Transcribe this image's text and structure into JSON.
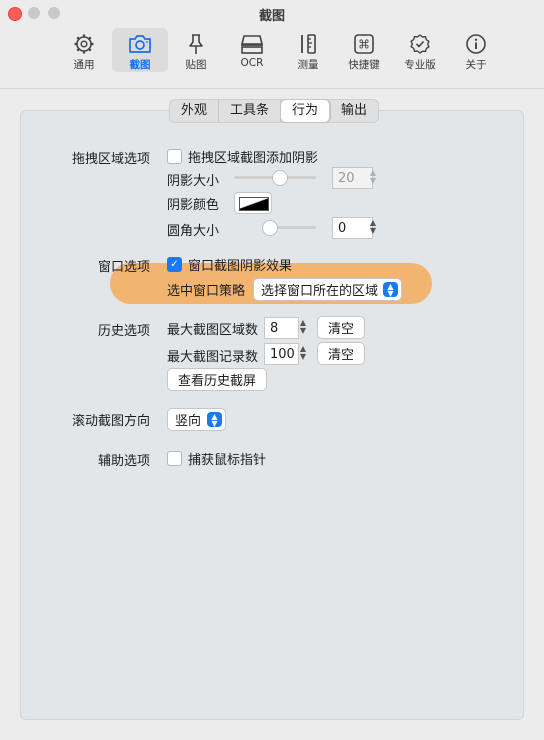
{
  "window": {
    "title": "截图"
  },
  "toolbar": {
    "items": [
      {
        "label": "通用",
        "icon": "gear-icon"
      },
      {
        "label": "截图",
        "icon": "camera-icon"
      },
      {
        "label": "贴图",
        "icon": "pin-icon"
      },
      {
        "label": "OCR",
        "icon": "scanner-icon"
      },
      {
        "label": "测量",
        "icon": "ruler-icon"
      },
      {
        "label": "快捷键",
        "icon": "command-key-icon"
      },
      {
        "label": "专业版",
        "icon": "verified-badge-icon"
      },
      {
        "label": "关于",
        "icon": "info-icon"
      }
    ],
    "active_index": 1
  },
  "tabs": {
    "items": [
      "外观",
      "工具条",
      "行为",
      "输出"
    ],
    "selected_index": 2
  },
  "drag_region": {
    "section_label": "拖拽区域选项",
    "shadow_checkbox_label": "拖拽区域截图添加阴影",
    "shadow_checked": false,
    "shadow_size_label": "阴影大小",
    "shadow_size_value": "20",
    "shadow_color_label": "阴影颜色",
    "corner_radius_label": "圆角大小",
    "corner_radius_value": "0"
  },
  "window_options": {
    "section_label": "窗口选项",
    "shadow_checkbox_label": "窗口截图阴影效果",
    "shadow_checked": true,
    "strategy_label": "选中窗口策略",
    "strategy_value": "选择窗口所在的区域"
  },
  "history": {
    "section_label": "历史选项",
    "max_region_label": "最大截图区域数",
    "max_region_value": "8",
    "max_record_label": "最大截图记录数",
    "max_record_value": "100",
    "clear_label": "清空",
    "view_history_label": "查看历史截屏"
  },
  "scroll": {
    "section_label": "滚动截图方向",
    "direction_value": "竖向"
  },
  "assist": {
    "section_label": "辅助选项",
    "cursor_checkbox_label": "捕获鼠标指针",
    "cursor_checked": false
  },
  "colors": {
    "accent": "#1a7af5",
    "highlight": "#f3b066",
    "close": "#ff5f57"
  }
}
